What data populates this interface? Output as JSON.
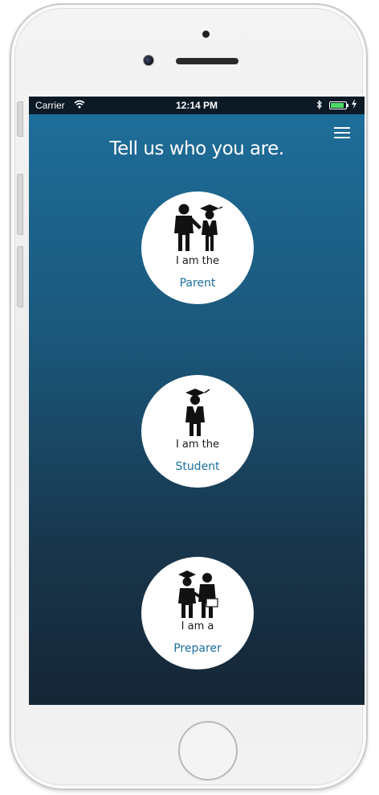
{
  "status_bar": {
    "carrier": "Carrier",
    "time": "12:14 PM"
  },
  "header": {
    "title": "Tell us who you are.",
    "menu_icon": "hamburger-menu-icon"
  },
  "roles": [
    {
      "prefix": "I am the",
      "label": "Parent",
      "icon": "parent-student-figures-icon"
    },
    {
      "prefix": "I am the",
      "label": "Student",
      "icon": "student-graduate-figure-icon"
    },
    {
      "prefix": "I am a",
      "label": "Preparer",
      "icon": "preparer-handshake-figures-icon"
    }
  ],
  "colors": {
    "accent": "#1c6f9f",
    "background_top": "#1e6f9c",
    "background_bottom": "#152635",
    "battery": "#4cd964"
  }
}
